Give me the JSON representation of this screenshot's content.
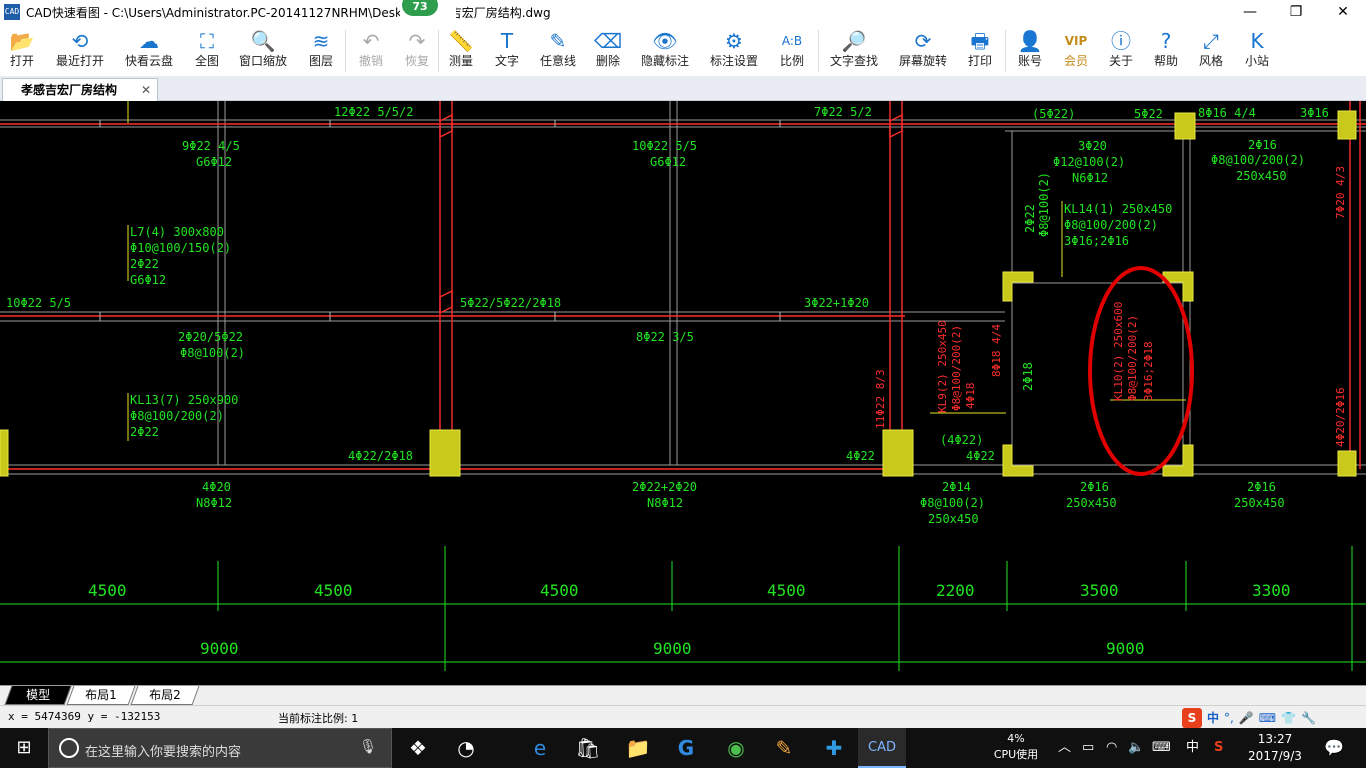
{
  "window": {
    "title": "CAD快速看图 - C:\\Users\\Administrator.PC-20141127NRHM\\Desktop\\孝感吉宏厂房结构.dwg",
    "title_badge": "73",
    "app_icon_text": "CAD",
    "controls": {
      "minimize": "—",
      "maximize": "❐",
      "close": "✕"
    }
  },
  "toolbar": {
    "items": [
      {
        "label": "打开",
        "icon": "folder-open-icon",
        "glyph": "📂",
        "enabled": true
      },
      {
        "label": "最近打开",
        "icon": "history-icon",
        "glyph": "⟲",
        "enabled": true
      },
      {
        "label": "快看云盘",
        "icon": "cloud-icon",
        "glyph": "☁",
        "enabled": true
      },
      {
        "label": "全图",
        "icon": "fit-all-icon",
        "glyph": "⛶",
        "enabled": true
      },
      {
        "label": "窗口缩放",
        "icon": "zoom-window-icon",
        "glyph": "🔍",
        "enabled": true
      },
      {
        "label": "图层",
        "icon": "layers-icon",
        "glyph": "≋",
        "enabled": true
      },
      {
        "label": "撤销",
        "icon": "undo-icon",
        "glyph": "↶",
        "enabled": false
      },
      {
        "label": "恢复",
        "icon": "redo-icon",
        "glyph": "↷",
        "enabled": false
      },
      {
        "label": "测量",
        "icon": "ruler-icon",
        "glyph": "📏",
        "enabled": true
      },
      {
        "label": "文字",
        "icon": "text-icon",
        "glyph": "T",
        "enabled": true
      },
      {
        "label": "任意线",
        "icon": "pen-icon",
        "glyph": "✎",
        "enabled": true
      },
      {
        "label": "删除",
        "icon": "eraser-icon",
        "glyph": "⌫",
        "enabled": true
      },
      {
        "label": "隐藏标注",
        "icon": "eye-hidden-icon",
        "glyph": "👁",
        "enabled": true
      },
      {
        "label": "标注设置",
        "icon": "settings-icon",
        "glyph": "⚙",
        "enabled": true
      },
      {
        "label": "比例",
        "icon": "scale-icon",
        "glyph": "A:B",
        "enabled": true
      },
      {
        "label": "文字查找",
        "icon": "text-search-icon",
        "glyph": "🔎",
        "enabled": true
      },
      {
        "label": "屏幕旋转",
        "icon": "rotate-screen-icon",
        "glyph": "⟳",
        "enabled": true
      },
      {
        "label": "打印",
        "icon": "printer-icon",
        "glyph": "🖶",
        "enabled": true
      },
      {
        "label": "账号",
        "icon": "user-icon",
        "glyph": "👤",
        "enabled": true
      },
      {
        "label": "会员",
        "icon": "vip-icon",
        "glyph": "VIP",
        "enabled": true
      },
      {
        "label": "关于",
        "icon": "info-icon",
        "glyph": "ⓘ",
        "enabled": true
      },
      {
        "label": "帮助",
        "icon": "help-icon",
        "glyph": "?",
        "enabled": true
      },
      {
        "label": "风格",
        "icon": "style-icon",
        "glyph": "⤢",
        "enabled": true
      },
      {
        "label": "小站",
        "icon": "kk-station-icon",
        "glyph": "K",
        "enabled": true
      }
    ]
  },
  "document_tab": {
    "label": "孝感吉宏厂房结构",
    "close": "✕"
  },
  "drawing": {
    "colors": {
      "background": "#000000",
      "green": "#22e322",
      "red": "#ff2d2d",
      "yellow": "#d4d41e",
      "annotation": "#e00000"
    },
    "labels": {
      "top_beams": [
        "12Φ22 5/5/2",
        "7Φ22 5/2",
        "(5Φ22)",
        "5Φ22",
        "8Φ16 4/4",
        "3Φ16"
      ],
      "l7": [
        "L7(4) 300x800",
        "Φ10@100/150(2)",
        "2Φ22",
        "G6Φ12"
      ],
      "upper_mid": [
        "9Φ22 4/5",
        "G6Φ12",
        "10Φ22 5/5",
        "G6Φ12",
        "3Φ20",
        "Φ12@100(2)",
        "N6Φ12",
        "2Φ16",
        "Φ8@100/200(2)",
        "250x450"
      ],
      "kl14": [
        "KL14(1) 250x450",
        "Φ8@100/200(2)",
        "3Φ16;2Φ16"
      ],
      "middle_row": [
        "10Φ22 5/5",
        "5Φ22/5Φ22/2Φ18",
        "3Φ22+1Φ20",
        "2Φ20/5Φ22",
        "Φ8@100(2)",
        "8Φ22 3/5"
      ],
      "kl13": [
        "KL13(7) 250x900",
        "Φ8@100/200(2)",
        "2Φ22"
      ],
      "lower_row": [
        "4Φ22/2Φ18",
        "4Φ22",
        "(4Φ22)",
        "4Φ22"
      ],
      "bottom_beams": [
        "4Φ20",
        "N8Φ12",
        "2Φ22+2Φ20",
        "N8Φ12",
        "2Φ14",
        "Φ8@100(2)",
        "250x450",
        "2Φ16",
        "250x450",
        "2Φ16",
        "250x450"
      ],
      "vertical_red": [
        "KL9(2) 250x450",
        "Φ8@100/200(2)",
        "4Φ18",
        "8Φ18 4/4",
        "11Φ22 8/3",
        "KL10(2) 250x600",
        "Φ8@100/200(2)",
        "3Φ16;2Φ18",
        "7Φ20 4/3",
        "4Φ20/2Φ16"
      ],
      "vertical_green": [
        "2Φ22",
        "Φ8@100(2)",
        "2Φ18"
      ]
    },
    "dimensions_row1": [
      "4500",
      "4500",
      "4500",
      "4500",
      "2200",
      "3500",
      "3300"
    ],
    "dimensions_row2": [
      "9000",
      "9000",
      "9000"
    ]
  },
  "layout_tabs": [
    {
      "label": "模型",
      "active": true
    },
    {
      "label": "布局1",
      "active": false
    },
    {
      "label": "布局2",
      "active": false
    }
  ],
  "statusbar": {
    "coords": "x = 5474369  y = -132153",
    "scale": "当前标注比例: 1",
    "ime": {
      "logo": "S",
      "lang": "中",
      "punct": "°,"
    }
  },
  "taskbar": {
    "search_placeholder": "在这里输入你要搜索的内容",
    "cpu_percent": "4%",
    "cpu_label": "CPU使用",
    "ime": "中",
    "time": "13:27",
    "date": "2017/9/3",
    "apps": [
      "task-view-icon",
      "browser-360-icon",
      "edge-icon",
      "store-icon",
      "explorer-icon",
      "g-app-icon",
      "green-app-icon",
      "notes-icon",
      "plus-app-icon",
      "cad-viewer-icon"
    ]
  }
}
